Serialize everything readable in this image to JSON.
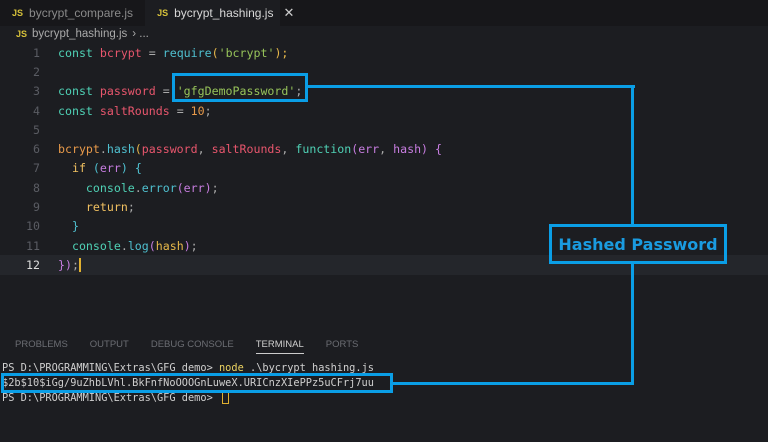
{
  "tabs": [
    {
      "label": "bycrypt_compare.js",
      "icon": "js-file-icon"
    },
    {
      "label": "bycrypt_hashing.js",
      "icon": "js-file-icon",
      "active": true
    }
  ],
  "tab_close": "✕",
  "file_badge": "JS",
  "breadcrumb": {
    "file": "bycrypt_hashing.js",
    "rest": "› ..."
  },
  "code": {
    "line_numbers": [
      "1",
      "2",
      "3",
      "4",
      "5",
      "6",
      "7",
      "8",
      "9",
      "10",
      "11",
      "12"
    ],
    "l1": [
      "const",
      "bcrypt",
      "=",
      "require",
      "(",
      "'bcrypt'",
      ");"
    ],
    "l3": [
      "const",
      "password",
      "=",
      "'gfgDemoPassword'",
      ";"
    ],
    "l4": [
      "const",
      "saltRounds",
      "=",
      "10",
      ";"
    ],
    "l6": [
      "bcrypt",
      ".",
      "hash",
      "(",
      "password",
      ",",
      "saltRounds",
      ",",
      "function",
      "(",
      "err",
      ",",
      "hash",
      ")",
      "{"
    ],
    "l7": [
      "if",
      "(",
      "err",
      ")",
      "{"
    ],
    "l8": [
      "console",
      ".",
      "error",
      "(",
      "err",
      ")",
      ";"
    ],
    "l9": [
      "return",
      ";"
    ],
    "l10": "}",
    "l11": [
      "console",
      ".",
      "log",
      "(",
      "hash",
      ")",
      ";"
    ],
    "l12": [
      "})",
      ";"
    ]
  },
  "panel_tabs": [
    "PROBLEMS",
    "OUTPUT",
    "DEBUG CONSOLE",
    "TERMINAL",
    "PORTS"
  ],
  "terminal": {
    "prompt": "PS D:\\PROGRAMMING\\Extras\\GFG demo> ",
    "command": "node",
    "args": " .\\bycrypt_hashing.js",
    "output": "$2b$10$iGg/9uZhbLVhl.BkFnfNoOOOGnLuweX.URICnzXIePPz5uCFrj7uu"
  },
  "annotation": {
    "label": "Hashed Password",
    "color": "#0a9ee6"
  }
}
